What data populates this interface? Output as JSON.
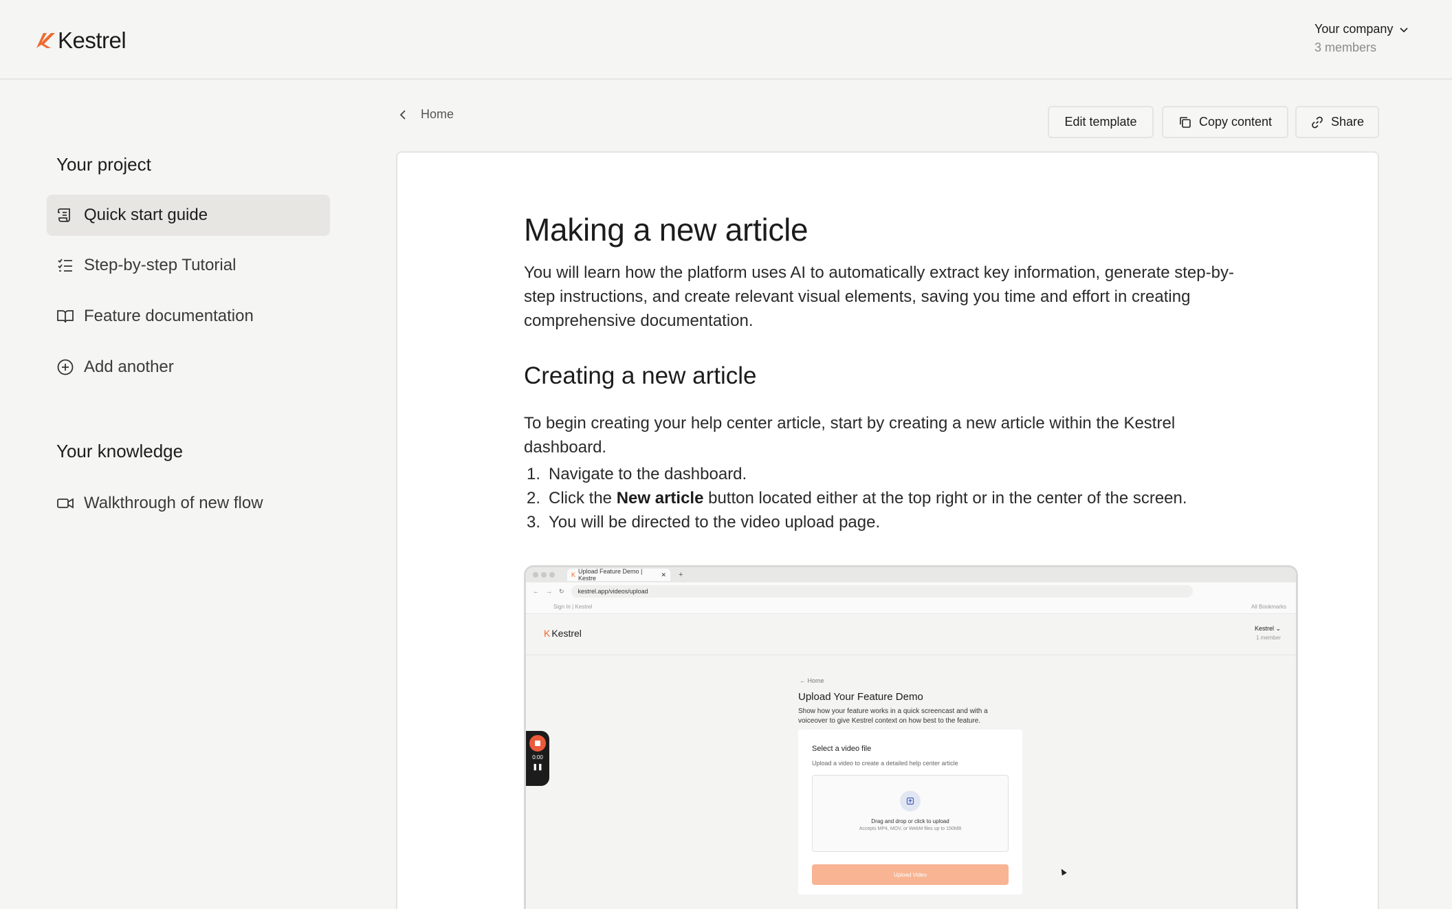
{
  "app": {
    "logo_text": "Kestrel",
    "brand_color": "#ee6a2f"
  },
  "header": {
    "company_name": "Your company",
    "company_members": "3 members"
  },
  "sidebar": {
    "project_heading": "Your project",
    "project_items": [
      {
        "label": "Quick start guide",
        "icon": "scroll-icon",
        "active": true
      },
      {
        "label": "Step-by-step Tutorial",
        "icon": "checklist-icon",
        "active": false
      },
      {
        "label": "Feature documentation",
        "icon": "book-icon",
        "active": false
      },
      {
        "label": "Add another",
        "icon": "plus-circle-icon",
        "active": false
      }
    ],
    "knowledge_heading": "Your knowledge",
    "knowledge_items": [
      {
        "label": "Walkthrough of new flow",
        "icon": "video-icon"
      }
    ]
  },
  "breadcrumb": {
    "label": "Home"
  },
  "toolbar": {
    "edit_label": "Edit template",
    "copy_label": "Copy content",
    "share_label": "Share"
  },
  "article": {
    "title": "Making a new article",
    "intro": "You will learn how the platform uses AI to automatically extract key information, generate step-by-step instructions, and create relevant visual elements, saving you time and effort in creating comprehensive documentation.",
    "section_title": "Creating a new article",
    "section_text": "To begin creating your help center article, start by creating a new article within the Kestrel dashboard.",
    "steps": [
      {
        "num": "1.",
        "before": "Navigate to the dashboard.",
        "bold": "",
        "after": ""
      },
      {
        "num": "2.",
        "before": "Click the ",
        "bold": "New article",
        "after": " button located either at the top right or in the center of the screen."
      },
      {
        "num": "3.",
        "before": "You will be directed to the video upload page.",
        "bold": "",
        "after": ""
      }
    ]
  },
  "screenshot": {
    "tab_title": "Upload Feature Demo | Kestre",
    "url": "kestrel.app/videos/upload",
    "bookmark": "Sign In | Kestrel",
    "all_bookmarks": "All Bookmarks",
    "logo_text": "Kestrel",
    "company": "Kestrel",
    "members": "1 member",
    "home": "Home",
    "title": "Upload Your Feature Demo",
    "desc": "Show how your feature works in a quick screencast and with a voiceover to give Kestrel context on how best to the feature.",
    "card_title": "Select a video file",
    "card_sub": "Upload a video to create a detailed help center article",
    "drop_title": "Drag and drop or click to upload",
    "drop_sub": "Accepts MP4, MOV, or WebM files up to 150MB",
    "upload_btn": "Upload Video",
    "rec_time": "0:00"
  }
}
